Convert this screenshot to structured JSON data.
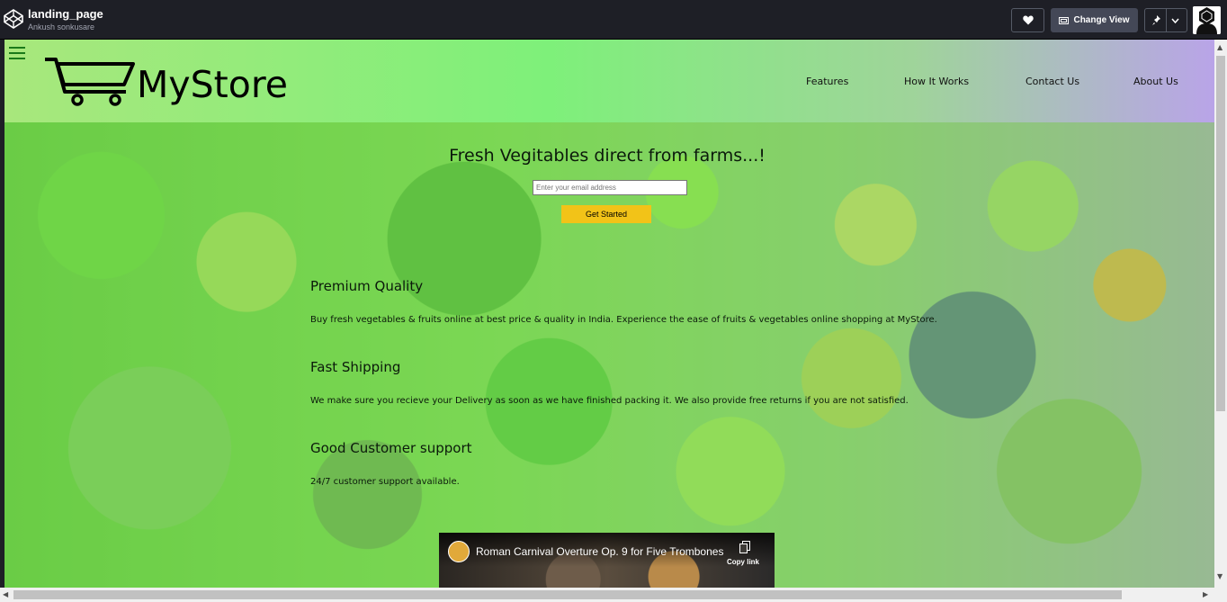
{
  "codepen": {
    "pen_title": "landing_page",
    "author": "Ankush sonkusare",
    "change_view_label": "Change View",
    "icons": [
      "codepen-logo-icon",
      "heart-icon",
      "change-view-icon",
      "pin-icon",
      "chevron-down-icon",
      "user-avatar"
    ]
  },
  "nav": {
    "brand": "MyStore",
    "links": [
      "Features",
      "How It Works",
      "Contact Us",
      "About Us"
    ]
  },
  "hero": {
    "title": "Fresh Vegitables direct from farms...!",
    "email_placeholder": "Enter your email address",
    "cta_label": "Get Started"
  },
  "features": [
    {
      "title": "Premium Quality",
      "desc": "Buy fresh vegetables & fruits online at best price & quality in India. Experience the ease of fruits & vegetables online shopping at MyStore."
    },
    {
      "title": "Fast Shipping",
      "desc": "We make sure you recieve your Delivery as soon as we have finished packing it. We also provide free returns if you are not satisfied."
    },
    {
      "title": "Good Customer support",
      "desc": "24/7 customer support available."
    }
  ],
  "video": {
    "title": "Roman Carnival Overture Op. 9 for Five Trombones",
    "copy_link": "Copy link"
  },
  "colors": {
    "codepen_bar": "#1e1f26",
    "cta": "#f2c318",
    "nav_gradient_start": "#a8e77c",
    "nav_gradient_end": "#b9a4e8"
  }
}
